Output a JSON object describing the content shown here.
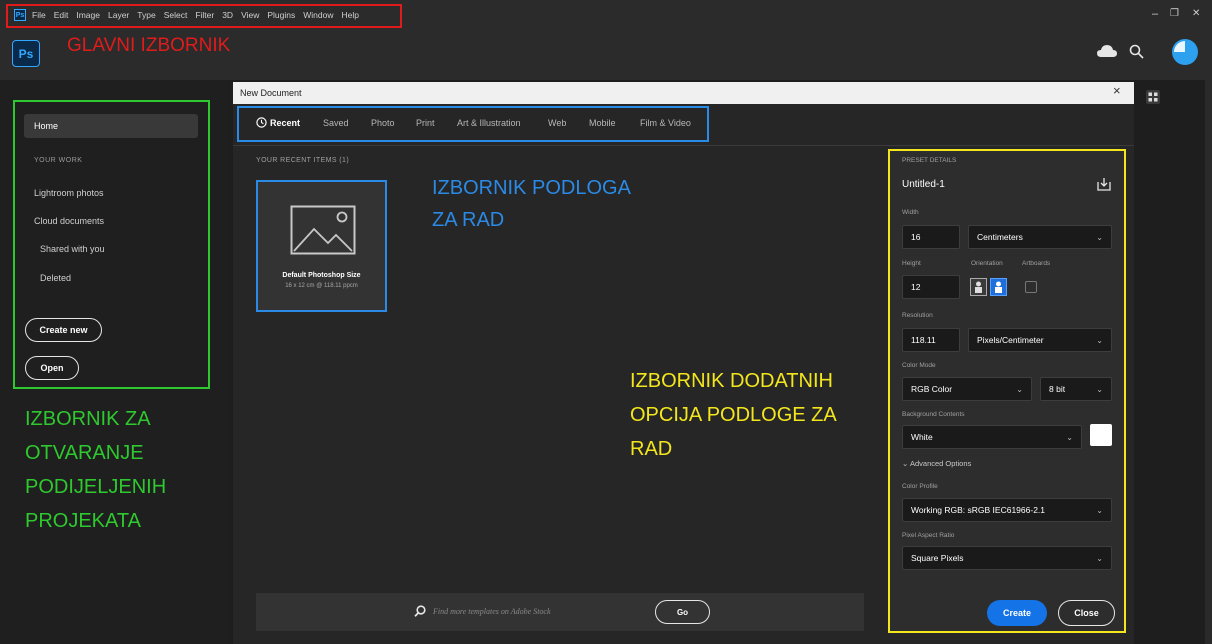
{
  "menubar": {
    "app_icon": "Ps",
    "items": [
      "File",
      "Edit",
      "Image",
      "Layer",
      "Type",
      "Select",
      "Filter",
      "3D",
      "View",
      "Plugins",
      "Window",
      "Help"
    ]
  },
  "appbar": {
    "logo": "Ps",
    "icons": [
      "cloud-icon",
      "search-icon",
      "avatar"
    ]
  },
  "sidebar": {
    "home": "Home",
    "section_label": "YOUR WORK",
    "links": [
      "Lightroom photos",
      "Cloud documents",
      "Shared with you",
      "Deleted"
    ],
    "create_new": "Create new",
    "open": "Open"
  },
  "dialog": {
    "title": "New Document",
    "close": "×",
    "tabs": [
      "Recent",
      "Saved",
      "Photo",
      "Print",
      "Art & Illustration",
      "Web",
      "Mobile",
      "Film & Video"
    ],
    "recent_heading": "YOUR RECENT ITEMS  (1)",
    "recent_item": {
      "name": "Default Photoshop Size",
      "details": "16 x 12 cm @ 118.11 ppcm"
    },
    "stock_placeholder": "Find more templates on Adobe Stock",
    "go": "Go"
  },
  "preset": {
    "heading": "PRESET DETAILS",
    "name": "Untitled-1",
    "width_label": "Width",
    "width_value": "16",
    "width_unit": "Centimeters",
    "height_label": "Height",
    "height_value": "12",
    "orientation_label": "Orientation",
    "artboards_label": "Artboards",
    "resolution_label": "Resolution",
    "resolution_value": "118.11",
    "resolution_unit": "Pixels/Centimeter",
    "color_mode_label": "Color Mode",
    "color_mode": "RGB Color",
    "bit_depth": "8 bit",
    "background_label": "Background Contents",
    "background": "White",
    "advanced": "Advanced Options",
    "color_profile_label": "Color Profile",
    "color_profile": "Working RGB: sRGB IEC61966-2.1",
    "pixel_aspect_label": "Pixel Aspect Ratio",
    "pixel_aspect": "Square Pixels",
    "create": "Create",
    "close": "Close"
  },
  "annotations": {
    "main_menu": "GLAVNI IZBORNIK",
    "canvas_menu_1": "IZBORNIK PODLOGA",
    "canvas_menu_2": "ZA RAD",
    "left_menu": [
      "IZBORNIK ZA",
      "OTVARANJE",
      "PODIJELJENIH",
      "PROJEKATA"
    ],
    "options_menu": [
      "IZBORNIK DODATNIH",
      "OPCIJA PODLOGE ZA",
      "RAD"
    ]
  },
  "colors": {
    "red": "#e01b1b",
    "blue": "#2a8ae6",
    "green": "#2ec92e",
    "yellow": "#f4e61c",
    "accent": "#1473e6"
  }
}
